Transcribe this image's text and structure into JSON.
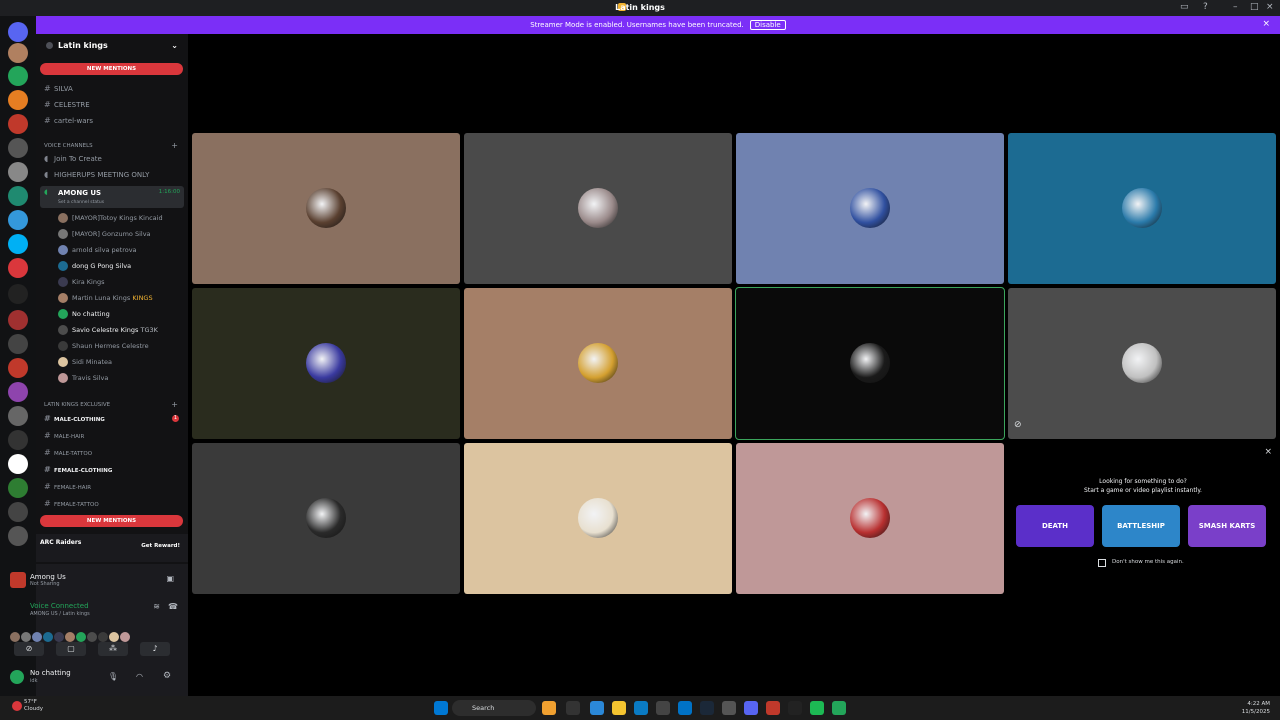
{
  "window": {
    "title": "Latin kings"
  },
  "banner": {
    "message": "Streamer Mode is enabled. Usernames have been truncated.",
    "disable": "Disable"
  },
  "guild": {
    "name": "Latin kings"
  },
  "pills": {
    "top": "NEW MENTIONS",
    "bottom": "NEW MENTIONS"
  },
  "text_channels": [
    "SILVA",
    "CELESTRE",
    "cartel-wars"
  ],
  "voice_category": "Voice Channels",
  "voice_channels": [
    "Join To Create",
    "HIGHERUPS MEETING ONLY"
  ],
  "active_channel": {
    "name": "AMONG US",
    "timer": "1:16:00",
    "status": "Set a channel status"
  },
  "members": [
    "[MAYOR]Totoy Kings Kincaid",
    "[MAYOR] Gonzumo Silva",
    "arnold silva petrova",
    "dong G Pong Silva",
    "Kira Kings",
    "Martin Luna Kings",
    "No chatting",
    "Savio Celestre Kings",
    "Shaun Hermes Celestre",
    "Sidi Minatea",
    "Travis Silva"
  ],
  "member_tags": {
    "martin": "KINGS",
    "savio": "TG3K"
  },
  "exclusive_category": "LATIN KINGS EXCLUSIVE",
  "exclusive_channels": [
    "MALE-CLOTHING",
    "MALE-HAIR",
    "MALE-TATTOO",
    "FEMALE-CLOTHING",
    "FEMALE-HAIR",
    "FEMALE-TATTOO"
  ],
  "exclusive_badge": "1",
  "promo": {
    "brand": "ARC Raiders",
    "button": "Get Reward!"
  },
  "activity_status": {
    "game": "Among Us",
    "sub": "Not Sharing"
  },
  "voice": {
    "status": "Voice Connected",
    "channel": "AMONG US / Latin kings"
  },
  "user": {
    "name": "No chatting",
    "sub": "idk"
  },
  "stage_tiles": [
    {
      "color": "#8a7060",
      "avatar": "#5a4030",
      "speaking": false
    },
    {
      "color": "#4a4a4a",
      "avatar": "#9a8a8a",
      "speaking": false
    },
    {
      "color": "#7082b0",
      "avatar": "#3050a0",
      "speaking": false
    },
    {
      "color": "#1c6b92",
      "avatar": "#2a7aaa",
      "speaking": false
    },
    {
      "color": "#2a2c1e",
      "avatar": "#3a3aa0",
      "speaking": false
    },
    {
      "color": "#a57f67",
      "avatar": "#d4a030",
      "speaking": false
    },
    {
      "color": "#0a0a0a",
      "avatar": "#1a1a1a",
      "speaking": true
    },
    {
      "color": "#4c4c4c",
      "avatar": "#c0c0c0",
      "speaking": false
    },
    {
      "color": "#3a3a3a",
      "avatar": "#2a2a2a",
      "speaking": false
    },
    {
      "color": "#dcc4a0",
      "avatar": "#e8e0d0",
      "speaking": false
    },
    {
      "color": "#bf9898",
      "avatar": "#b83030",
      "speaking": false
    }
  ],
  "activity": {
    "line1": "Looking for something to do?",
    "line2": "Start a game or video playlist instantly.",
    "games": [
      "DEATH",
      "BATTLESHIP",
      "SMASH KARTS"
    ],
    "dont_show": "Don't show me this again."
  },
  "taskbar": {
    "search": "Search",
    "weather_temp": "57°F",
    "weather_desc": "Cloudy",
    "time": "4:22 AM",
    "date": "11/5/2025"
  }
}
